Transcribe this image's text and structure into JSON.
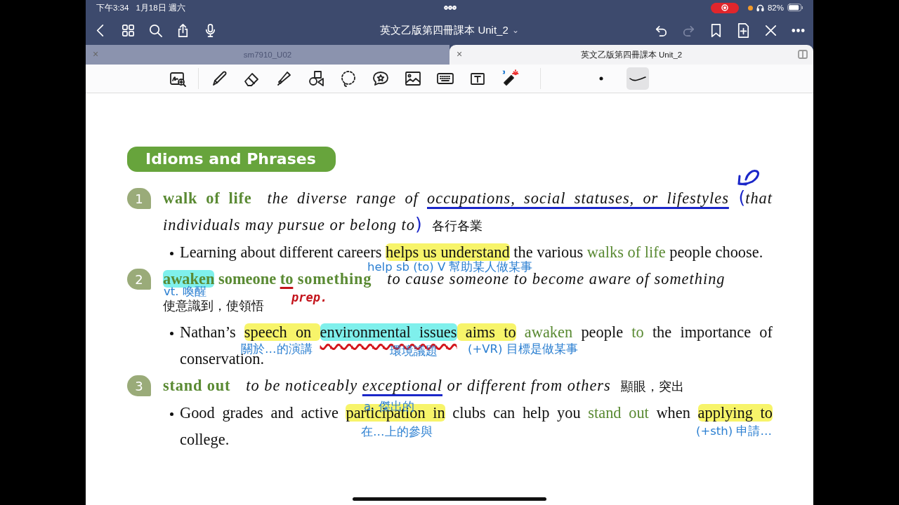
{
  "status_bar": {
    "time": "下午3:34",
    "date": "1月18日 週六",
    "recording": true,
    "battery": "82%"
  },
  "nav": {
    "title": "英文乙版第四冊課本 Unit_2",
    "title_caret": "⌄",
    "redo_disabled": true
  },
  "tabs": [
    {
      "close": "×",
      "label": "sm7910_U02",
      "selected": false
    },
    {
      "close": "×",
      "label": "英文乙版第四冊課本 Unit_2",
      "selected": true
    }
  ],
  "toolbar": {
    "pen_styles": [
      {
        "kind": "dot",
        "selected": false
      },
      {
        "kind": "curve",
        "selected": true
      }
    ]
  },
  "document": {
    "heading": "Idioms and Phrases",
    "entries": [
      {
        "number": "1",
        "text": [
          {
            "text": "walk of life",
            "kind": "term"
          },
          {
            "text": "the diverse range of ",
            "kind": "definition"
          },
          {
            "text": "occupations, social statuses, or lifestyles",
            "kind": "definition",
            "underlined": true
          },
          {
            "text": " (",
            "kind": "ink"
          },
          {
            "text": "that individuals may pursue or belong to",
            "kind": "definition"
          },
          {
            "text": ")",
            "kind": "ink"
          },
          {
            "text": "各行各業",
            "kind": "gloss"
          }
        ],
        "example": [
          {
            "text": "Learning about different careers ",
            "kind": "plain"
          },
          {
            "text": "helps us understand",
            "kind": "plain",
            "highlighted": true,
            "color": "#f7f46a"
          },
          {
            "text": " the various ",
            "kind": "plain"
          },
          {
            "text": "walks of life",
            "kind": "green"
          },
          {
            "text": " people choose.",
            "kind": "plain"
          }
        ]
      },
      {
        "number": "2",
        "text": [
          {
            "text": "awaken",
            "kind": "term-part",
            "highlighted": true,
            "color": "#7ff0ec"
          },
          {
            "text": " someone ",
            "kind": "term-part"
          },
          {
            "text": "to",
            "kind": "term-part",
            "underlined": true
          },
          {
            "text": " something",
            "kind": "term"
          },
          {
            "text": "to cause someone to become aware of something",
            "kind": "definition"
          },
          {
            "text": "使意識到，使領悟",
            "kind": "gloss-line"
          }
        ],
        "example": [
          {
            "text": "Nathan’s ",
            "kind": "plain"
          },
          {
            "text": "speech on ",
            "kind": "plain",
            "highlighted": true,
            "color": "#f7f46a"
          },
          {
            "text": "environmental issues",
            "kind": "plain",
            "highlighted": true,
            "color": "#7ff0ec",
            "wavy": true
          },
          {
            "text": " aims to",
            "kind": "plain",
            "highlighted": true,
            "color": "#f7f46a"
          },
          {
            "text": " awaken",
            "kind": "green"
          },
          {
            "text": " people ",
            "kind": "plain"
          },
          {
            "text": "to",
            "kind": "green"
          },
          {
            "text": " the importance of conservation.",
            "kind": "plain"
          }
        ]
      },
      {
        "number": "3",
        "text": [
          {
            "text": "stand out",
            "kind": "term"
          },
          {
            "text": "to be noticeably ",
            "kind": "definition"
          },
          {
            "text": "exceptional",
            "kind": "definition",
            "underlined": true
          },
          {
            "text": " or different from others",
            "kind": "definition"
          },
          {
            "text": "顯眼，突出",
            "kind": "gloss"
          }
        ],
        "example": [
          {
            "text": "Good grades and active ",
            "kind": "plain"
          },
          {
            "text": "participation in",
            "kind": "plain",
            "highlighted": true,
            "color": "#f7f46a"
          },
          {
            "text": " clubs can help you ",
            "kind": "plain"
          },
          {
            "text": "stand out",
            "kind": "green"
          },
          {
            "text": " when ",
            "kind": "plain"
          },
          {
            "text": "applying to",
            "kind": "plain",
            "highlighted": true,
            "color": "#f7f46a"
          },
          {
            "text": " college.",
            "kind": "plain"
          }
        ]
      }
    ],
    "notes": [
      {
        "text": "help sb (to) V 幫助某人做某事",
        "kind": "typed",
        "color": "#2b7fd1"
      },
      {
        "text": "vt. 喚醒",
        "kind": "typed",
        "color": "#2b7fd1"
      },
      {
        "text": "prep.",
        "kind": "script",
        "color": "#c4141c"
      },
      {
        "text": "關於…的演講",
        "kind": "typed",
        "color": "#2b7fd1"
      },
      {
        "text": "環境議題",
        "kind": "typed",
        "color": "#2b7fd1"
      },
      {
        "text": "(+VR) 目標是做某事",
        "kind": "typed",
        "color": "#2b7fd1"
      },
      {
        "text": "a. 傑出的",
        "kind": "typed",
        "color": "#2b7fd1"
      },
      {
        "text": "在…上的參與",
        "kind": "typed",
        "color": "#2b7fd1"
      },
      {
        "text": "(+sth) 申請…",
        "kind": "typed",
        "color": "#2b7fd1"
      }
    ]
  }
}
